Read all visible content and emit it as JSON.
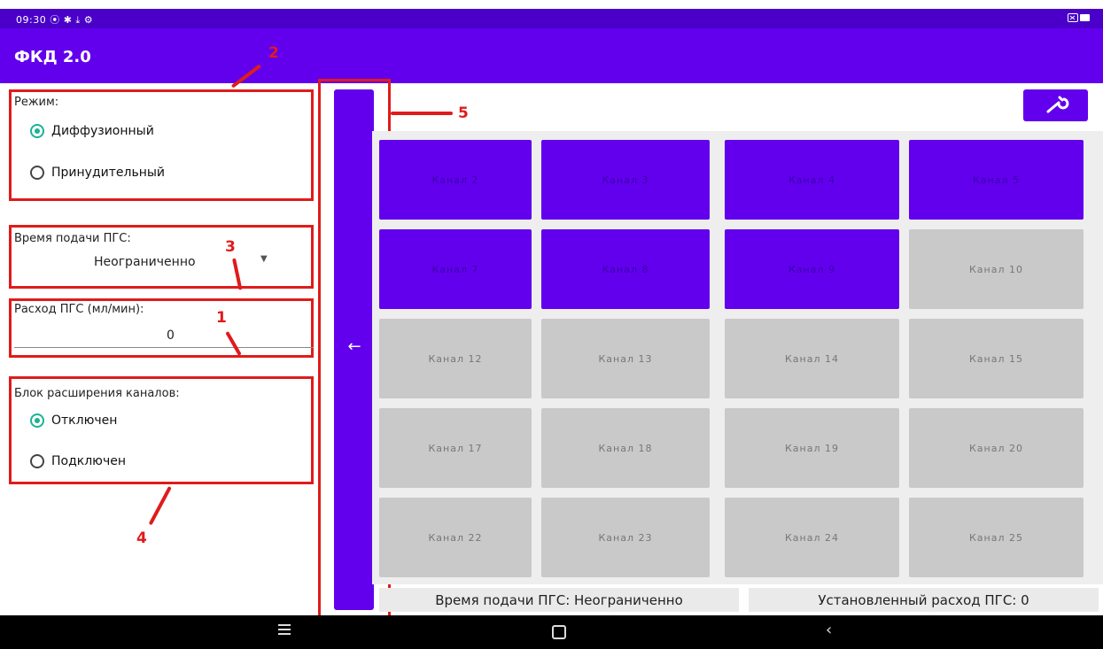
{
  "status_bar": {
    "time": "09:30",
    "icons_left": "⦿ ✱ ⤓ ⚙",
    "battery_icon": "battery-icon"
  },
  "app_bar": {
    "title": "ФКД 2.0"
  },
  "mode": {
    "label": "Режим:",
    "options": [
      "Диффузионный",
      "Принудительный"
    ],
    "selected": 0
  },
  "supply_time": {
    "label": "Время подачи ПГС:",
    "value": "Неограниченно"
  },
  "flow": {
    "label": "Расход ПГС (мл/мин):",
    "value": "0"
  },
  "expansion": {
    "label": "Блок расширения каналов:",
    "options": [
      "Отключен",
      "Подключен"
    ],
    "selected": 0
  },
  "annotations": [
    "1",
    "2",
    "3",
    "4",
    "5"
  ],
  "channels": [
    {
      "label": "Канал 2",
      "active": true
    },
    {
      "label": "Канал 3",
      "active": true
    },
    {
      "label": "Канал 4",
      "active": true
    },
    {
      "label": "Канал 5",
      "active": true
    },
    {
      "label": "Канал 7",
      "active": true
    },
    {
      "label": "Канал 8",
      "active": true
    },
    {
      "label": "Канал 9",
      "active": true
    },
    {
      "label": "Канал 10",
      "active": false
    },
    {
      "label": "Канал 12",
      "active": false
    },
    {
      "label": "Канал 13",
      "active": false
    },
    {
      "label": "Канал 14",
      "active": false
    },
    {
      "label": "Канал 15",
      "active": false
    },
    {
      "label": "Канал 17",
      "active": false
    },
    {
      "label": "Канал 18",
      "active": false
    },
    {
      "label": "Канал 19",
      "active": false
    },
    {
      "label": "Канал 20",
      "active": false
    },
    {
      "label": "Канал 22",
      "active": false
    },
    {
      "label": "Канал 23",
      "active": false
    },
    {
      "label": "Канал 24",
      "active": false
    },
    {
      "label": "Канал 25",
      "active": false
    }
  ],
  "footer": {
    "supply_time_text": "Время подачи ПГС: Неограниченно",
    "flow_text": "Установленный расход ПГС: 0"
  },
  "icons": {
    "collapse": "arrow-left-icon",
    "settings": "wrench-icon",
    "nav": [
      "menu-icon",
      "home-icon",
      "back-icon"
    ]
  },
  "colors": {
    "primary": "#6200ee",
    "status": "#4a00c8",
    "annotation": "#e01b1b",
    "radio": "#1ab394",
    "tile_idle": "#c9c9c9"
  }
}
